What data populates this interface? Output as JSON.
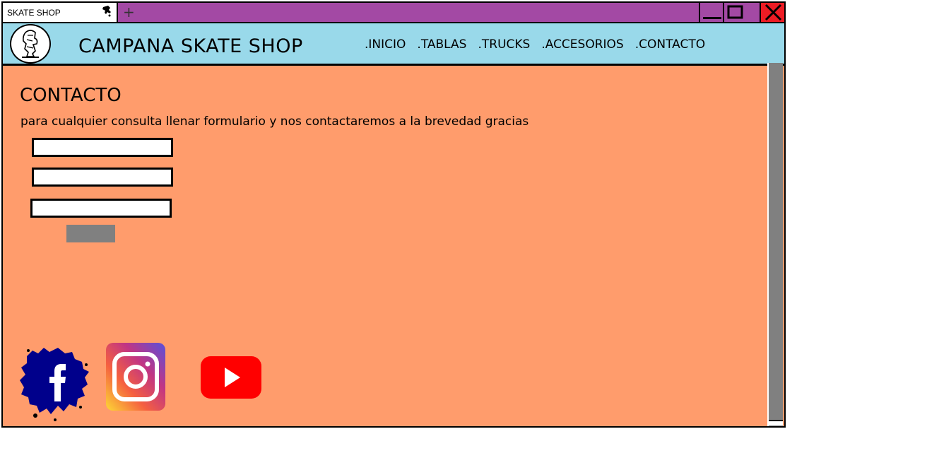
{
  "browser": {
    "tab_title": "SKATE SHOP",
    "new_tab_symbol": "+",
    "tab_icon": "skater-favicon-icon",
    "controls": [
      "minimize-icon",
      "maximize-icon",
      "close-icon"
    ],
    "colors": {
      "titlebar": "#a349a4",
      "close": "#ed1c24"
    }
  },
  "header": {
    "brand": "CAMPANA SKATE SHOP",
    "logo_icon": "skater-logo-icon",
    "nav": [
      ".INICIO",
      ".TABLAS",
      ".TRUCKS",
      ".ACCESORIOS",
      ".CONTACTO"
    ],
    "colors": {
      "background": "#99d9ea"
    }
  },
  "main": {
    "title": "CONTACTO",
    "description": "para cualquier consulta llenar formulario y nos contactaremos a la brevedad gracias",
    "fields": [
      "",
      "",
      ""
    ],
    "submit_label": "",
    "colors": {
      "background": "#ff9c6c",
      "button": "#808080"
    }
  },
  "social": [
    {
      "icon": "facebook-icon",
      "color": "#00008b"
    },
    {
      "icon": "instagram-icon",
      "color": "#c13584"
    },
    {
      "icon": "youtube-icon",
      "color": "#ff0000"
    }
  ]
}
